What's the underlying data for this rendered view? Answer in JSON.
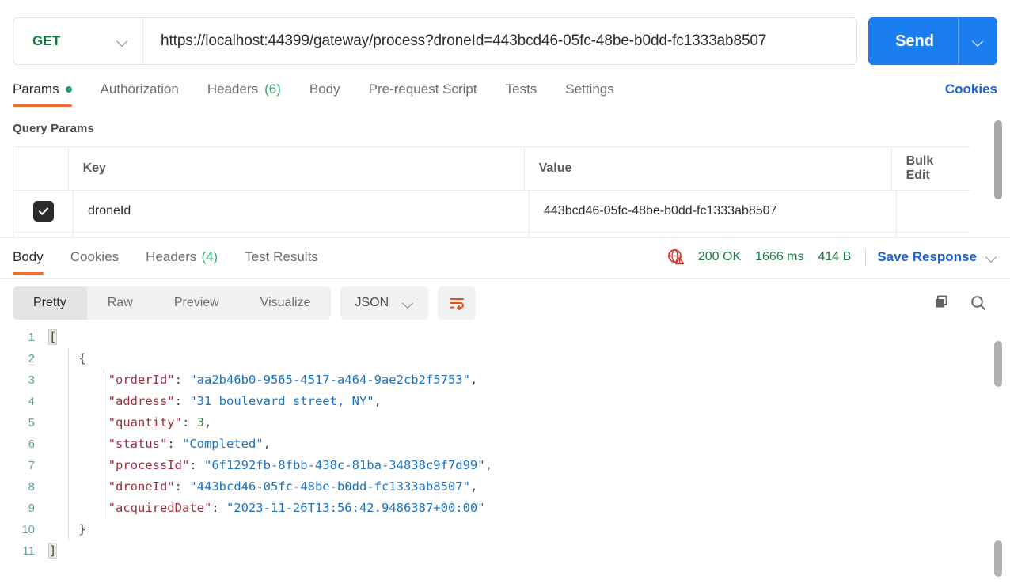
{
  "request": {
    "method": "GET",
    "method_color": "#0f7c3f",
    "url": "https://localhost:44399/gateway/process?droneId=443bcd46-05fc-48be-b0dd-fc1333ab8507",
    "send_label": "Send",
    "send_color": "#1a7ef0",
    "method_chevron_icon": "chevron-down-icon",
    "send_chevron_icon": "chevron-down-icon"
  },
  "request_tabs": {
    "items": [
      {
        "label": "Params",
        "active": true,
        "dot": true,
        "count": ""
      },
      {
        "label": "Authorization",
        "active": false,
        "dot": false,
        "count": ""
      },
      {
        "label": "Headers",
        "active": false,
        "dot": false,
        "count": "(6)"
      },
      {
        "label": "Body",
        "active": false,
        "dot": false,
        "count": ""
      },
      {
        "label": "Pre-request Script",
        "active": false,
        "dot": false,
        "count": ""
      },
      {
        "label": "Tests",
        "active": false,
        "dot": false,
        "count": ""
      },
      {
        "label": "Settings",
        "active": false,
        "dot": false,
        "count": ""
      }
    ],
    "cookies_label": "Cookies",
    "active_underline_color": "#ef6c34",
    "dot_color": "#22a06b",
    "link_color": "#1a62d8"
  },
  "query_params": {
    "title": "Query Params",
    "columns": {
      "key": "Key",
      "value": "Value",
      "bulk_edit": "Bulk Edit"
    },
    "rows": [
      {
        "checked": true,
        "key": "droneId",
        "value": "443bcd46-05fc-48be-b0dd-fc1333ab8507"
      }
    ]
  },
  "response_tabs": {
    "items": [
      {
        "label": "Body",
        "active": true,
        "count": ""
      },
      {
        "label": "Cookies",
        "active": false,
        "count": ""
      },
      {
        "label": "Headers",
        "active": false,
        "count": "(4)"
      },
      {
        "label": "Test Results",
        "active": false,
        "count": ""
      }
    ],
    "status": "200 OK",
    "time": "1666 ms",
    "size": "414 B",
    "save_response_label": "Save Response",
    "status_color": "#1a7a46",
    "warning_icon": "globe-warning-icon",
    "save_chevron_icon": "chevron-down-icon"
  },
  "format_toolbar": {
    "views": [
      {
        "label": "Pretty",
        "active": true
      },
      {
        "label": "Raw",
        "active": false
      },
      {
        "label": "Preview",
        "active": false
      },
      {
        "label": "Visualize",
        "active": false
      }
    ],
    "language": "JSON",
    "language_chevron_icon": "chevron-down-icon",
    "wrap_icon": "word-wrap-icon",
    "copy_icon": "copy-icon",
    "search_icon": "search-icon",
    "wrap_icon_color": "#d9531e"
  },
  "response_body": {
    "lines": [
      {
        "n": "1",
        "indent": 0,
        "tokens": [
          {
            "t": "[",
            "c": "p brace-hl"
          }
        ]
      },
      {
        "n": "2",
        "indent": 1,
        "tokens": [
          {
            "t": "{",
            "c": "p"
          }
        ]
      },
      {
        "n": "3",
        "indent": 2,
        "tokens": [
          {
            "t": "\"orderId\"",
            "c": "k"
          },
          {
            "t": ": ",
            "c": "p"
          },
          {
            "t": "\"aa2b46b0-9565-4517-a464-9ae2cb2f5753\"",
            "c": "s"
          },
          {
            "t": ",",
            "c": "p"
          }
        ]
      },
      {
        "n": "4",
        "indent": 2,
        "tokens": [
          {
            "t": "\"address\"",
            "c": "k"
          },
          {
            "t": ": ",
            "c": "p"
          },
          {
            "t": "\"31 boulevard street, NY\"",
            "c": "s"
          },
          {
            "t": ",",
            "c": "p"
          }
        ]
      },
      {
        "n": "5",
        "indent": 2,
        "tokens": [
          {
            "t": "\"quantity\"",
            "c": "k"
          },
          {
            "t": ": ",
            "c": "p"
          },
          {
            "t": "3",
            "c": "n"
          },
          {
            "t": ",",
            "c": "p"
          }
        ]
      },
      {
        "n": "6",
        "indent": 2,
        "tokens": [
          {
            "t": "\"status\"",
            "c": "k"
          },
          {
            "t": ": ",
            "c": "p"
          },
          {
            "t": "\"Completed\"",
            "c": "s"
          },
          {
            "t": ",",
            "c": "p"
          }
        ]
      },
      {
        "n": "7",
        "indent": 2,
        "tokens": [
          {
            "t": "\"processId\"",
            "c": "k"
          },
          {
            "t": ": ",
            "c": "p"
          },
          {
            "t": "\"6f1292fb-8fbb-438c-81ba-34838c9f7d99\"",
            "c": "s"
          },
          {
            "t": ",",
            "c": "p"
          }
        ]
      },
      {
        "n": "8",
        "indent": 2,
        "tokens": [
          {
            "t": "\"droneId\"",
            "c": "k"
          },
          {
            "t": ": ",
            "c": "p"
          },
          {
            "t": "\"443bcd46-05fc-48be-b0dd-fc1333ab8507\"",
            "c": "s"
          },
          {
            "t": ",",
            "c": "p"
          }
        ]
      },
      {
        "n": "9",
        "indent": 2,
        "tokens": [
          {
            "t": "\"acquiredDate\"",
            "c": "k"
          },
          {
            "t": ": ",
            "c": "p"
          },
          {
            "t": "\"2023-11-26T13:56:42.9486387+00:00\"",
            "c": "s"
          }
        ]
      },
      {
        "n": "10",
        "indent": 1,
        "tokens": [
          {
            "t": "}",
            "c": "p"
          }
        ]
      },
      {
        "n": "11",
        "indent": 0,
        "tokens": [
          {
            "t": "]",
            "c": "p brace-hl"
          }
        ]
      }
    ]
  }
}
